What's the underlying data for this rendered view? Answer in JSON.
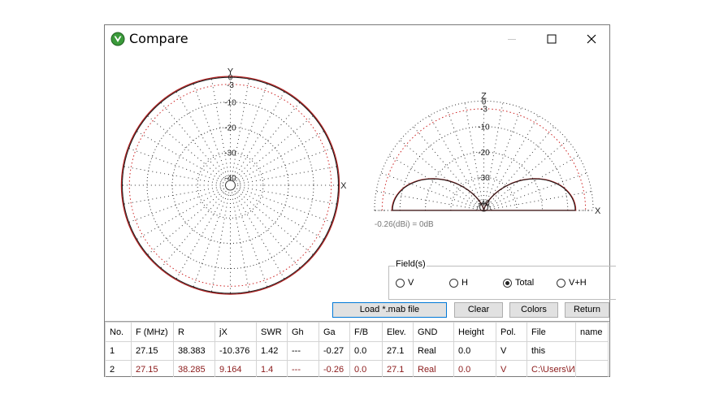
{
  "window": {
    "title": "Compare"
  },
  "plots": {
    "azimuth": {
      "axis_top": "Y",
      "axis_right": "X",
      "ring_labels": [
        "0",
        "-3",
        "-10",
        "-20",
        "-30",
        "-40"
      ]
    },
    "elevation": {
      "axis_top": "Z",
      "axis_right": "X",
      "ring_labels": [
        "0",
        "-3",
        "-10",
        "-20",
        "-30",
        "-40"
      ],
      "gain_note": "-0.26(dBi) = 0dB"
    },
    "colors": {
      "series1": "#1a1a1a",
      "series2": "#b22222"
    }
  },
  "fields": {
    "legend": "Field(s)",
    "options": [
      {
        "label": "V",
        "selected": false
      },
      {
        "label": "H",
        "selected": false
      },
      {
        "label": "Total",
        "selected": true
      },
      {
        "label": "V+H",
        "selected": false
      }
    ]
  },
  "buttons": {
    "load": "Load *.mab file",
    "clear": "Clear",
    "colors": "Colors",
    "return": "Return"
  },
  "table": {
    "headers": [
      "No.",
      "F (MHz)",
      "R",
      "jX",
      "SWR",
      "Gh",
      "Ga",
      "F/B",
      "Elev.",
      "GND",
      "Height",
      "Pol.",
      "File",
      "name"
    ],
    "rows": [
      [
        "1",
        "27.15",
        "38.383",
        "-10.376",
        "1.42",
        "---",
        "-0.27",
        "0.0",
        "27.1",
        "Real",
        "0.0",
        "V",
        "this",
        ""
      ],
      [
        "2",
        "27.15",
        "38.285",
        "9.164",
        "1.4",
        "---",
        "-0.26",
        "0.0",
        "27.1",
        "Real",
        "0.0",
        "V",
        "C:\\Users\\И",
        ""
      ]
    ]
  }
}
